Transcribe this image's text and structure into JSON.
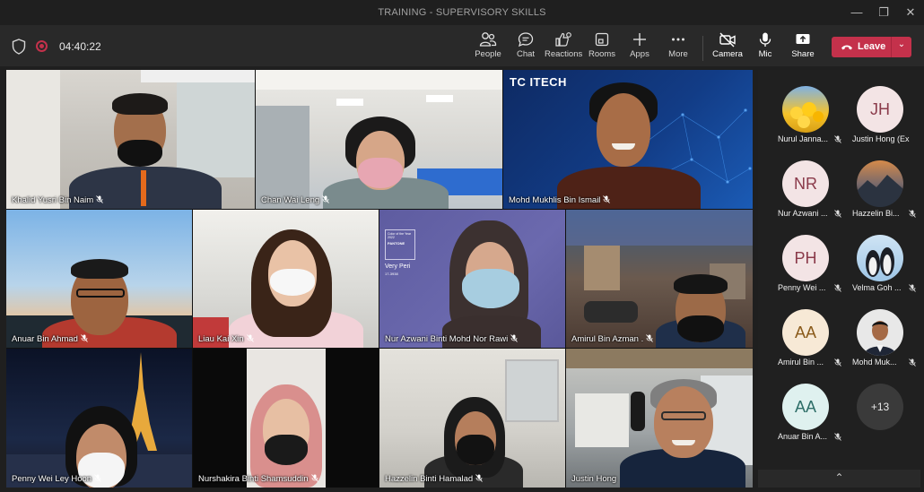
{
  "window": {
    "title": "TRAINING - SUPERVISORY SKILLS"
  },
  "meeting": {
    "elapsed": "04:40:22",
    "recording": true
  },
  "toolbar": {
    "people": "People",
    "chat": "Chat",
    "reactions": "Reactions",
    "rooms": "Rooms",
    "apps": "Apps",
    "more": "More",
    "camera": "Camera",
    "mic": "Mic",
    "share": "Share",
    "leave": "Leave"
  },
  "video_tiles": [
    {
      "name": "Khalid Yusri Bin Naim"
    },
    {
      "name": "Chan Wai Leng"
    },
    {
      "name": "Mohd Mukhlis Bin Ismail",
      "background_text": "TC ITECH"
    },
    {
      "name": "Anuar Bin Ahmad"
    },
    {
      "name": "Liau Kai Xin"
    },
    {
      "name": "Nur Azwani Binti Mohd Nor Rawi",
      "background_text": [
        "Color of the Year 2022",
        "PANTONE",
        "Very Peri",
        "17-3938"
      ]
    },
    {
      "name": "Amirul Bin Azman ."
    },
    {
      "name": "Penny Wei Ley Hoon"
    },
    {
      "name": "Nurshakira Binti Shamsuddin"
    },
    {
      "name": "Hazzelin Binti Hamalad"
    },
    {
      "name": "Justin Hong"
    }
  ],
  "participants": [
    {
      "name": "Nurul Janna...",
      "avatar": "photo-flowers"
    },
    {
      "name": "Justin Hong (Ex...",
      "initials": "JH"
    },
    {
      "name": "Nur Azwani ...",
      "initials": "NR"
    },
    {
      "name": "Hazzelin Bi...",
      "avatar": "photo-landscape"
    },
    {
      "name": "Penny Wei ...",
      "initials": "PH"
    },
    {
      "name": "Velma Goh ...",
      "avatar": "photo-penguins"
    },
    {
      "name": "Amirul Bin ...",
      "initials": "AA"
    },
    {
      "name": "Mohd Muk...",
      "avatar": "photo-man"
    },
    {
      "name": "Anuar Bin A...",
      "initials": "AA"
    },
    {
      "more_count": "+13"
    }
  ],
  "colors": {
    "leave": "#c4314b",
    "avatar_bg": "#f5e6e6",
    "avatar_text": "#8a3a4a",
    "avatar_bg_teal": "#e0f2f0",
    "avatar_text_teal": "#2e6e68"
  }
}
